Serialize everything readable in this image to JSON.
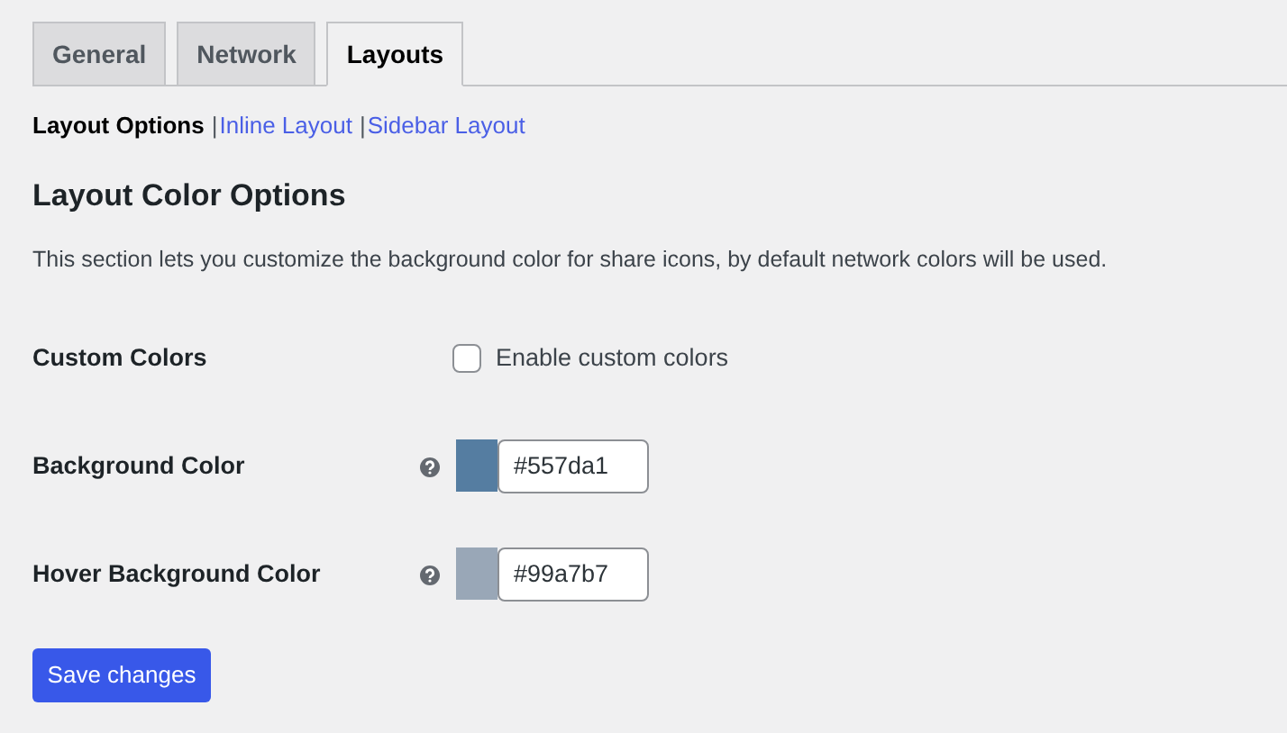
{
  "tabs": [
    {
      "label": "General",
      "selected": false
    },
    {
      "label": "Network",
      "selected": false
    },
    {
      "label": "Layouts",
      "selected": true
    }
  ],
  "subnav": [
    {
      "label": "Layout Options",
      "selected": true
    },
    {
      "separator": "|",
      "label": "Inline Layout",
      "selected": false
    },
    {
      "separator": "|",
      "label": "Sidebar Layout",
      "selected": false
    }
  ],
  "heading": "Layout Color Options",
  "description": "This section lets you customize the background color for share icons, by default network colors will be used.",
  "fields": [
    {
      "kind": "checkbox",
      "label": "Custom Colors",
      "option": "Enable custom colors",
      "checked": false
    },
    {
      "kind": "color",
      "label": "Background Color",
      "value": "#557da1",
      "color": "#557da1"
    },
    {
      "kind": "color",
      "label": "Hover Background Color",
      "value": "#99a7b7",
      "color": "#99a7b7"
    }
  ],
  "save_button": "Save changes"
}
